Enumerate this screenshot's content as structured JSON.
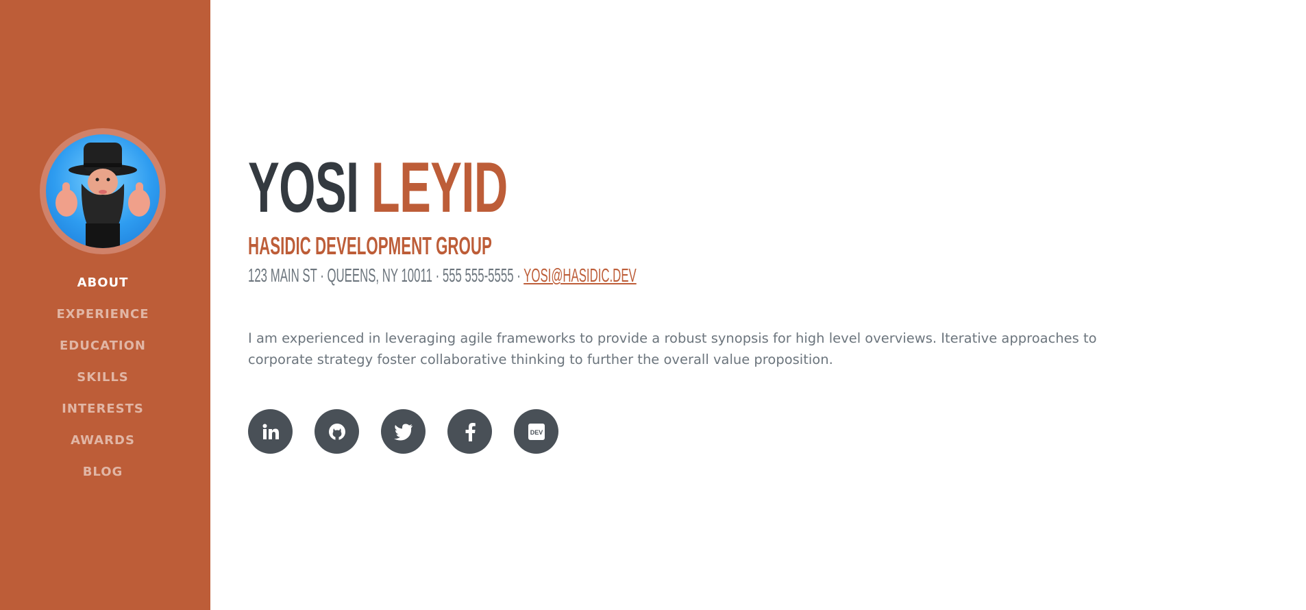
{
  "sidebar": {
    "avatar_alt": "profile-avatar",
    "nav": [
      {
        "label": "About",
        "active": true
      },
      {
        "label": "Experience",
        "active": false
      },
      {
        "label": "Education",
        "active": false
      },
      {
        "label": "Skills",
        "active": false
      },
      {
        "label": "Interests",
        "active": false
      },
      {
        "label": "Awards",
        "active": false
      },
      {
        "label": "Blog",
        "active": false
      }
    ]
  },
  "about": {
    "first_name": "YOSI",
    "last_name": "LEYID",
    "company": "HASIDIC DEVELOPMENT GROUP",
    "contact_text": "123 MAIN ST · QUEENS, NY 10011 · 555 555-5555 · ",
    "email": "YOSI@HASIDIC.DEV",
    "intro": "I am experienced in leveraging agile frameworks to provide a robust synopsis for high level overviews. Iterative approaches to corporate strategy foster collaborative thinking to further the overall value proposition."
  },
  "social": [
    {
      "icon": "linkedin-icon",
      "glyph": "in"
    },
    {
      "icon": "github-icon",
      "glyph": ""
    },
    {
      "icon": "twitter-icon",
      "glyph": ""
    },
    {
      "icon": "facebook-icon",
      "glyph": "f"
    },
    {
      "icon": "dev-icon",
      "glyph": "DEV"
    }
  ],
  "colors": {
    "accent": "#bd5d38",
    "dark": "#343a40",
    "muted": "#6c757d",
    "icon_bg": "#495057"
  }
}
